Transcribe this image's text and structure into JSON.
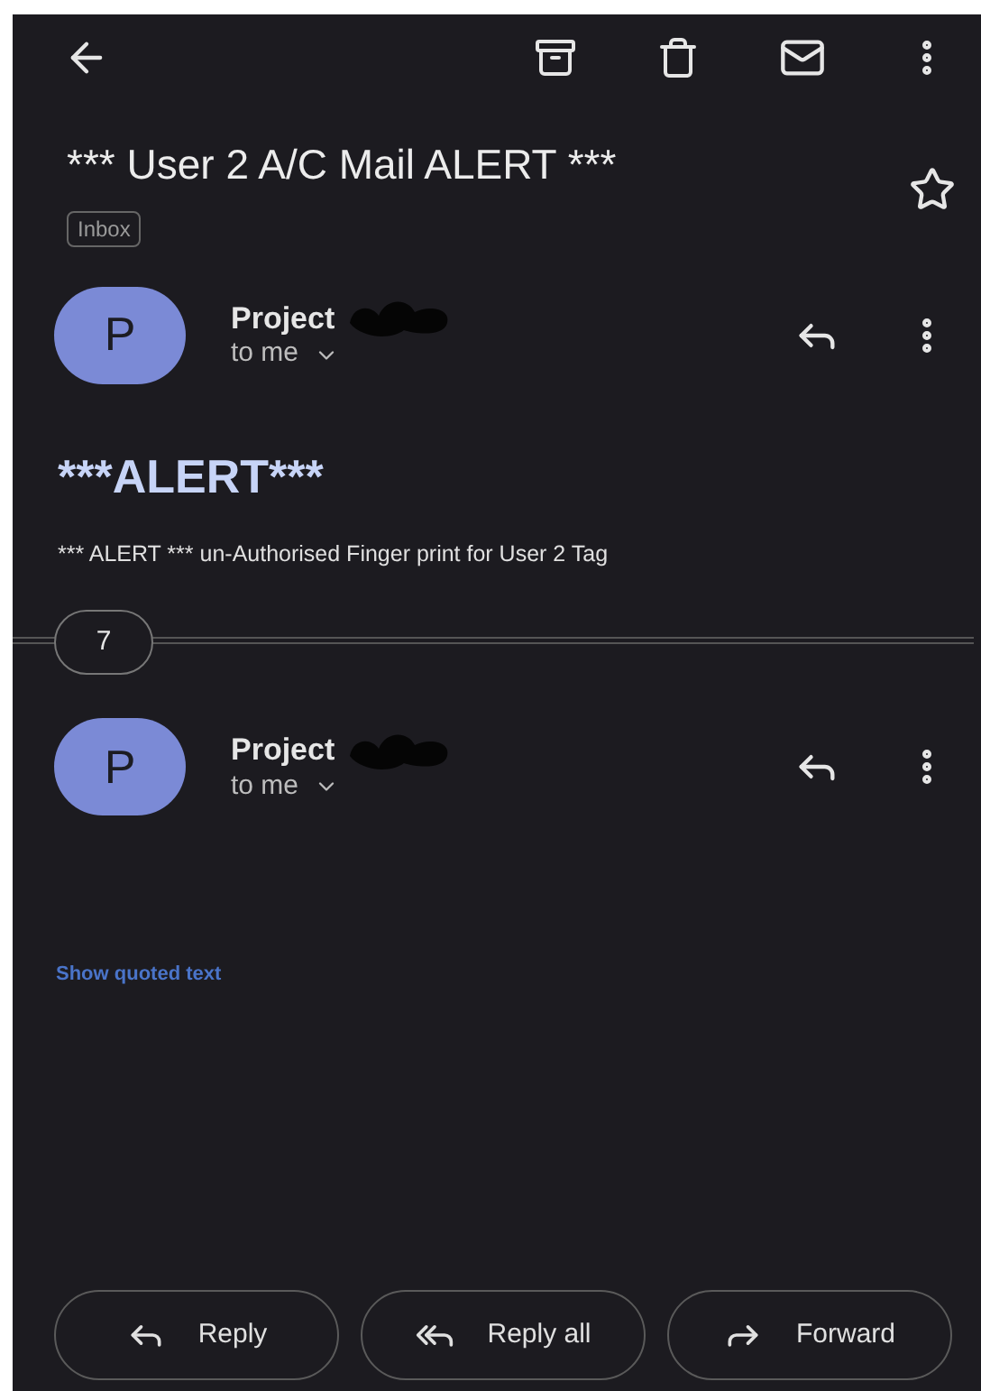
{
  "subject": "*** User 2 A/C Mail ALERT ***",
  "label": "Inbox",
  "starred": false,
  "messages": [
    {
      "avatar": "P",
      "sender": "Project",
      "recipient": "to me",
      "redacted": true
    },
    {
      "avatar": "P",
      "sender": "Project",
      "recipient": "to me",
      "redacted": true
    }
  ],
  "body": {
    "heading": "***ALERT***",
    "text": "*** ALERT *** un-Authorised Finger print for User 2 Tag"
  },
  "collapsed_count": "7",
  "show_quoted": "Show quoted text",
  "actions": [
    {
      "kind": "reply",
      "label": "Reply"
    },
    {
      "kind": "reply_all",
      "label": "Reply all"
    },
    {
      "kind": "forward",
      "label": "Forward"
    }
  ]
}
